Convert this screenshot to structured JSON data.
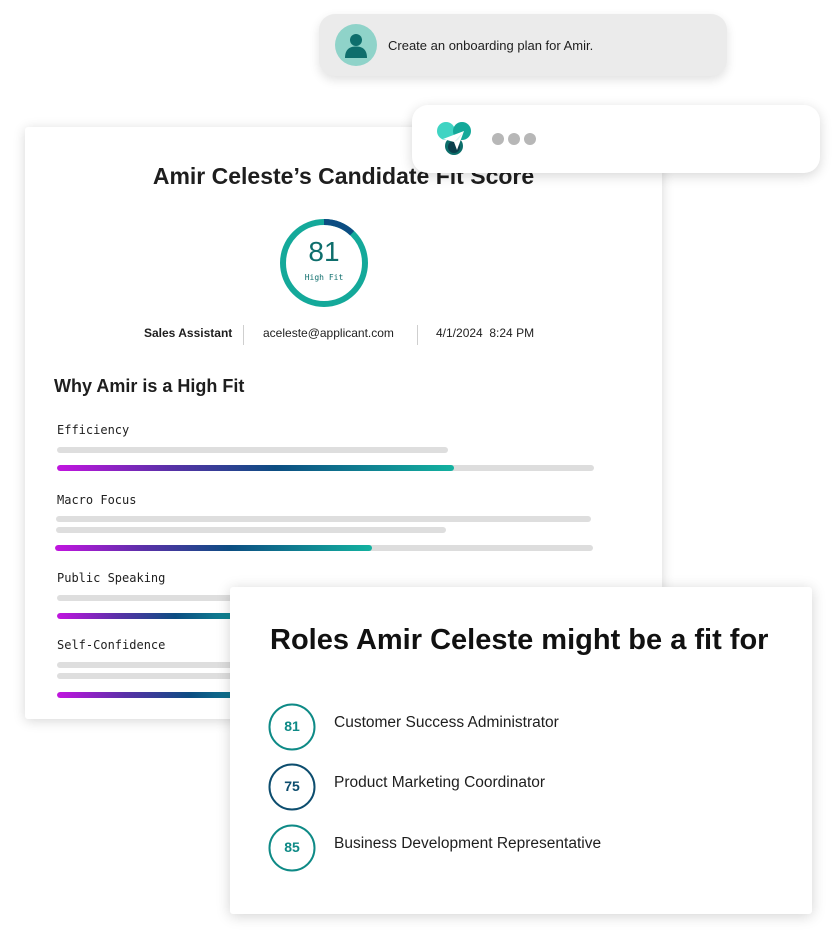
{
  "prompt": {
    "text": "Create an onboarding plan for Amir.",
    "avatar_icon": "user-icon"
  },
  "assistant": {
    "logo_icon": "assistant-logo-icon",
    "status": "typing"
  },
  "fit_card": {
    "title": "Amir Celeste’s Candidate Fit Score",
    "score": {
      "value": "81",
      "label": "High Fit",
      "fraction": 0.81,
      "ring_color": "#14a99a",
      "ring_accent_color": "#0c4d82"
    },
    "meta": {
      "role": "Sales Assistant",
      "email": "aceleste@applicant.com",
      "datetime": "4/1/2024  8:24 PM"
    },
    "why_heading": "Why Amir is a High Fit",
    "skills": [
      {
        "label": "Efficiency",
        "progress": 0.74
      },
      {
        "label": "Macro Focus",
        "progress": 0.59
      },
      {
        "label": "Public Speaking",
        "progress": 0.4
      },
      {
        "label": "Self-Confidence",
        "progress": 0.45
      }
    ]
  },
  "roles_card": {
    "title": "Roles Amir Celeste might be a fit for",
    "roles": [
      {
        "score": "81",
        "name": "Customer Success Administrator",
        "color": "#0e8a86"
      },
      {
        "score": "75",
        "name": "Product Marketing Coordinator",
        "color": "#0c4d6e"
      },
      {
        "score": "85",
        "name": "Business Development Representative",
        "color": "#0e8a86"
      }
    ]
  },
  "colors": {
    "teal": "#14a99a",
    "navy": "#0c4d82",
    "magenta": "#c214e0",
    "bubble_gray": "#ebebeb"
  }
}
